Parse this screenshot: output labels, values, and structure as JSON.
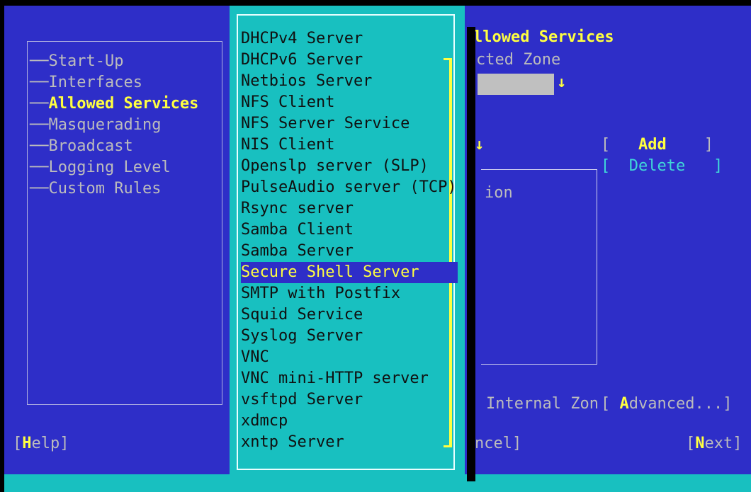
{
  "nav_tree": {
    "items": [
      {
        "label": "Start-Up",
        "current": false
      },
      {
        "label": "Interfaces",
        "current": false
      },
      {
        "label": "Allowed Services",
        "current": true
      },
      {
        "label": "Masquerading",
        "current": false
      },
      {
        "label": "Broadcast",
        "current": false
      },
      {
        "label": "Logging Level",
        "current": false
      },
      {
        "label": "Custom Rules",
        "current": false
      }
    ]
  },
  "right_panel": {
    "title_fragment": "llowed Services",
    "zone_label_fragment": "cted Zone",
    "combo_arrow": "↓",
    "service_arrow": "↓",
    "add_label": "Add",
    "delete_label": "Delete",
    "list_header_fragment": "ion",
    "internal_zone_fragment": "Internal Zon",
    "advanced_label": "Advanced..."
  },
  "bottom_buttons": {
    "help_label": "Help",
    "cancel_fragment": "ncel]",
    "next_label": "Next"
  },
  "service_popup": {
    "options": [
      "DHCPv4 Server",
      "DHCPv6 Server",
      "Netbios Server",
      "NFS Client",
      "NFS Server Service",
      "NIS Client",
      "Openslp server (SLP)",
      "PulseAudio server (TCP)",
      "Rsync server",
      "Samba Client",
      "Samba Server",
      "Secure Shell Server",
      "SMTP with Postfix",
      "Squid Service",
      "Syslog Server",
      "VNC",
      "VNC mini-HTTP server",
      "vsftpd Server",
      "xdmcp",
      "xntp Server"
    ],
    "selected": "Secure Shell Server"
  },
  "colors": {
    "background": "#2e2ec8",
    "popup": "#18c0c0",
    "highlight_text": "#ffff40"
  }
}
